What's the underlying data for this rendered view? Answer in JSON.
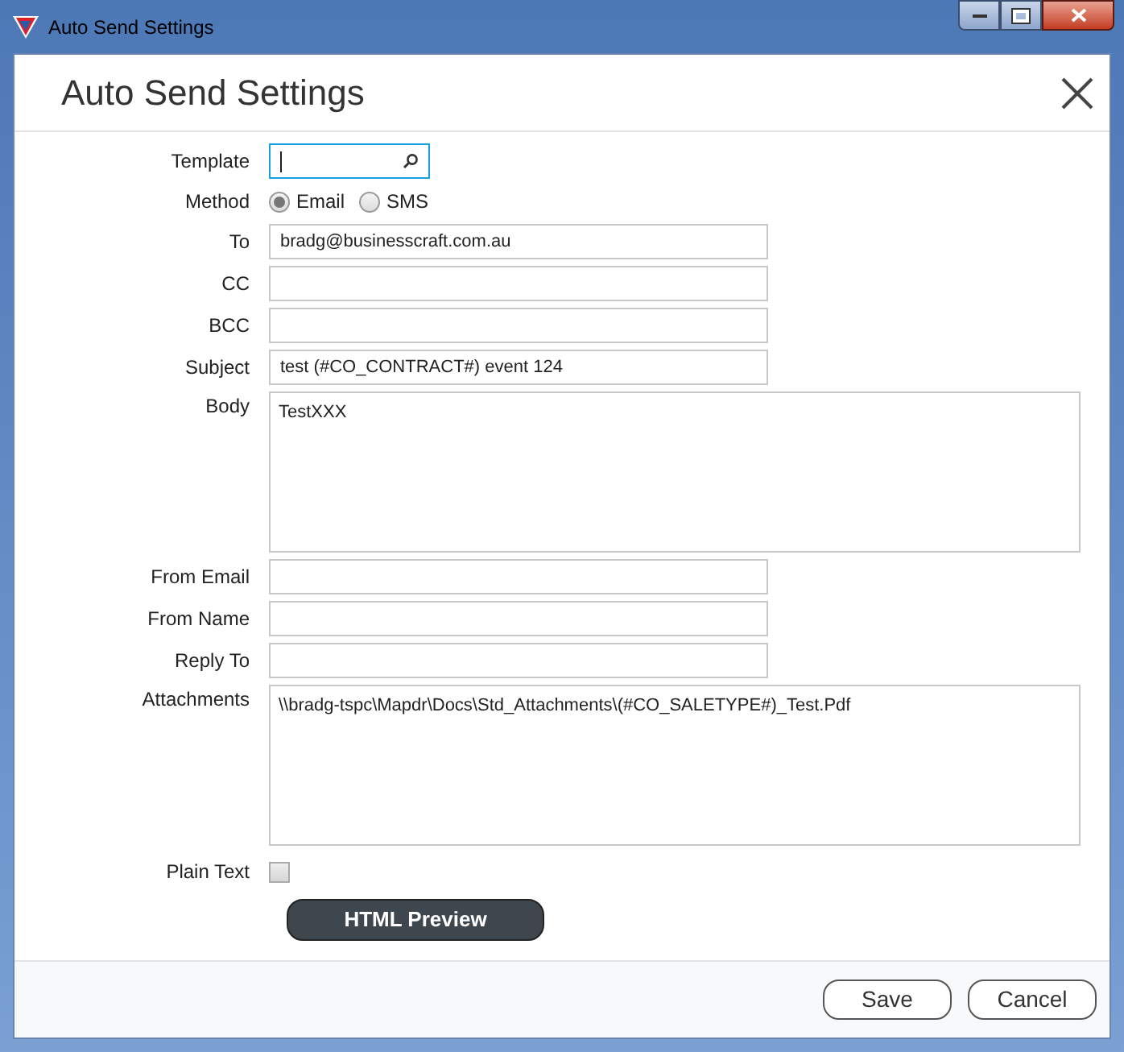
{
  "window": {
    "title": "Auto Send Settings"
  },
  "dialog": {
    "title": "Auto Send Settings"
  },
  "fields": [
    {
      "kind": "search",
      "label": "Template",
      "focused": true
    },
    {
      "kind": "radio",
      "label": "Method",
      "options": [
        {
          "label": "Email",
          "selected": true
        },
        {
          "label": "SMS",
          "selected": false
        }
      ]
    },
    {
      "kind": "text",
      "label": "To",
      "value": "bradg@businesscraft.com.au"
    },
    {
      "kind": "text",
      "label": "CC"
    },
    {
      "kind": "text",
      "label": "BCC"
    },
    {
      "kind": "text",
      "label": "Subject",
      "value": "test (#CO_CONTRACT#) event 124"
    },
    {
      "kind": "textarea",
      "label": "Body",
      "value": "TestXXX"
    },
    {
      "kind": "text",
      "label": "From Email"
    },
    {
      "kind": "text",
      "label": "From Name"
    },
    {
      "kind": "text",
      "label": "Reply To"
    },
    {
      "kind": "textarea",
      "label": "Attachments",
      "value": "\\\\bradg-tspc\\Mapdr\\Docs\\Std_Attachments\\(#CO_SALETYPE#)_Test.Pdf"
    },
    {
      "kind": "checkbox",
      "label": "Plain Text",
      "checked": false
    }
  ],
  "preview_button": "HTML Preview",
  "buttons": [
    "Save",
    "Cancel"
  ]
}
